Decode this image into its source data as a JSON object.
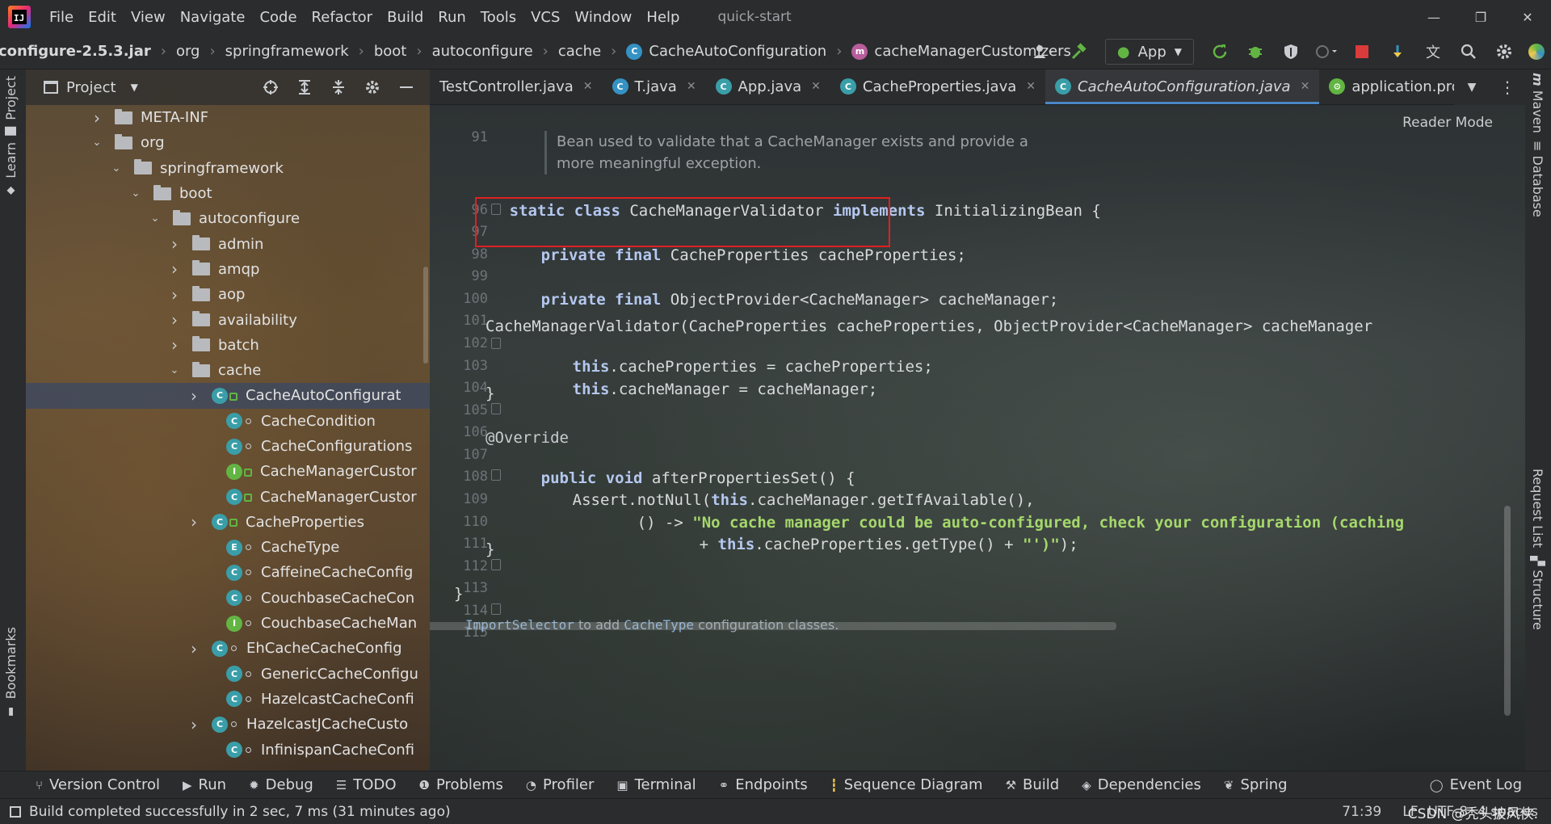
{
  "app": {
    "logo_text": "IJ",
    "menu": [
      "File",
      "Edit",
      "View",
      "Navigate",
      "Code",
      "Refactor",
      "Build",
      "Run",
      "Tools",
      "VCS",
      "Window",
      "Help"
    ],
    "window_title": "quick-start",
    "window_controls": {
      "minimize": "—",
      "restore": "❐",
      "close": "✕"
    }
  },
  "breadcrumb": {
    "items": [
      "configure-2.5.3.jar",
      "org",
      "springframework",
      "boot",
      "autoconfigure",
      "cache",
      "CacheAutoConfiguration",
      "cacheManagerCustomizers"
    ],
    "run_config": "App"
  },
  "left_stripe": {
    "project": "Project",
    "learn": "Learn",
    "bookmarks": "Bookmarks"
  },
  "project_panel": {
    "title": "Project",
    "tree": [
      {
        "label": "META-INF",
        "kind": "folder",
        "expanded": false
      },
      {
        "label": "org",
        "kind": "folder",
        "expanded": true
      },
      {
        "label": "springframework",
        "kind": "folder",
        "expanded": true
      },
      {
        "label": "boot",
        "kind": "folder",
        "expanded": true
      },
      {
        "label": "autoconfigure",
        "kind": "folder",
        "expanded": true
      },
      {
        "label": "admin",
        "kind": "folder",
        "expanded": false
      },
      {
        "label": "amqp",
        "kind": "folder",
        "expanded": false
      },
      {
        "label": "aop",
        "kind": "folder",
        "expanded": false
      },
      {
        "label": "availability",
        "kind": "folder",
        "expanded": false
      },
      {
        "label": "batch",
        "kind": "folder",
        "expanded": false
      },
      {
        "label": "cache",
        "kind": "folder",
        "expanded": true
      },
      {
        "label": "CacheAutoConfigurat",
        "kind": "class",
        "icon": "C"
      },
      {
        "label": "CacheCondition",
        "kind": "class",
        "icon": "C"
      },
      {
        "label": "CacheConfigurations",
        "kind": "class",
        "icon": "C"
      },
      {
        "label": "CacheManagerCustor",
        "kind": "interface",
        "icon": "I"
      },
      {
        "label": "CacheManagerCustor",
        "kind": "class",
        "icon": "C"
      },
      {
        "label": "CacheProperties",
        "kind": "class",
        "icon": "C"
      },
      {
        "label": "CacheType",
        "kind": "enum",
        "icon": "E"
      },
      {
        "label": "CaffeineCacheConfig",
        "kind": "class",
        "icon": "C"
      },
      {
        "label": "CouchbaseCacheCon",
        "kind": "class",
        "icon": "C"
      },
      {
        "label": "CouchbaseCacheMan",
        "kind": "interface",
        "icon": "I"
      },
      {
        "label": "EhCacheCacheConfig",
        "kind": "class",
        "icon": "C"
      },
      {
        "label": "GenericCacheConfigu",
        "kind": "class",
        "icon": "C"
      },
      {
        "label": "HazelcastCacheConfi",
        "kind": "class",
        "icon": "C"
      },
      {
        "label": "HazelcastJCacheCusto",
        "kind": "class",
        "icon": "C"
      },
      {
        "label": "InfinispanCacheConfi",
        "kind": "class",
        "icon": "C"
      }
    ]
  },
  "tabs": [
    {
      "label": "TestController.java",
      "active": false
    },
    {
      "label": "T.java",
      "active": false
    },
    {
      "label": "App.java",
      "active": false
    },
    {
      "label": "CacheProperties.java",
      "active": false
    },
    {
      "label": "CacheAutoConfiguration.java",
      "active": true
    },
    {
      "label": "application.properties",
      "active": false
    }
  ],
  "editor": {
    "reader_mode": "Reader Mode",
    "doc_comment": "Bean used to validate that a CacheManager exists and provide a more meaningful exception.",
    "line_numbers": [
      "91",
      "96",
      "97",
      "98",
      "99",
      "100",
      "101",
      "102",
      "103",
      "104",
      "105",
      "106",
      "107",
      "108",
      "109",
      "110",
      "111",
      "112",
      "113",
      "114",
      "115"
    ],
    "code_lines": [
      [
        "kw",
        "static class "
      ],
      [
        "t",
        "CacheManagerValidator "
      ],
      [
        "kw",
        "implements "
      ],
      [
        "t",
        "InitializingBean {"
      ]
    ],
    "lines": {
      "l96": "static class CacheManagerValidator implements InitializingBean {",
      "l98_kw": "private final ",
      "l98_t": "CacheProperties cacheProperties;",
      "l100_kw": "private final ",
      "l100_t": "ObjectProvider<CacheManager> cacheManager;",
      "l102": "CacheManagerValidator(CacheProperties cacheProperties, ObjectProvider<CacheManager> cacheManager",
      "l103_kw": "this",
      "l103_t": ".cacheProperties = cacheProperties;",
      "l104_kw": "this",
      "l104_t": ".cacheManager = cacheManager;",
      "l105": "}",
      "l107": "@Override",
      "l108_kw": "public void ",
      "l108_t": "afterPropertiesSet() {",
      "l109_a": "Assert.notNull(",
      "l109_kw": "this",
      "l109_b": ".cacheManager.getIfAvailable(),",
      "l110_a": "() -> ",
      "l110_str": "\"No cache manager could be auto-configured, check your configuration (caching",
      "l111_a": "+ ",
      "l111_kw": "this",
      "l111_b": ".cacheProperties.getType() + ",
      "l111_str": "\"')\"",
      "l111_c": ");",
      "l112": "}",
      "l114": "}"
    },
    "bottom_hint_code1": "ImportSelector",
    "bottom_hint_text": " to add ",
    "bottom_hint_code2": "CacheType",
    "bottom_hint_text2": " configuration classes."
  },
  "right_stripe": {
    "maven": "Maven",
    "database": "Database",
    "request_list": "Request List",
    "structure": "Structure"
  },
  "bottom_tools": [
    "Version Control",
    "Run",
    "Debug",
    "TODO",
    "Problems",
    "Profiler",
    "Terminal",
    "Endpoints",
    "Sequence Diagram",
    "Build",
    "Dependencies",
    "Spring"
  ],
  "event_log": "Event Log",
  "status": {
    "message": "Build completed successfully in 2 sec, 7 ms (31 minutes ago)",
    "position": "71:39",
    "line_sep": "LF",
    "encoding": "UTF-8",
    "indent": "4 spaces",
    "watermark": "CSDN @秃头披风侠."
  },
  "colors": {
    "highlight_box": "#e02020",
    "keyword": "#9ab8e6",
    "string": "#a5d86b",
    "tab_underline": "#4a88c7"
  }
}
